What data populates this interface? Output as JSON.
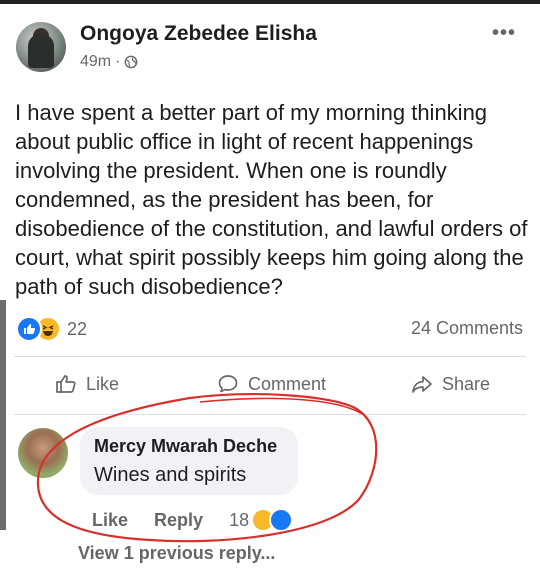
{
  "post": {
    "author": "Ongoya Zebedee Elisha",
    "time": "49m",
    "separator": "·",
    "more": "•••",
    "text": "I have spent a better part of my morning thinking about public office in light of recent happenings involving the president. When one is roundly condemned, as the president has been, for disobedience of the constitution, and lawful orders of court, what spirit possibly keeps him going along the path of such disobedience?",
    "reaction_count": "22",
    "comments_label": "24 Comments"
  },
  "actions": {
    "like": "Like",
    "comment": "Comment",
    "share": "Share"
  },
  "comment": {
    "author": "Mercy Mwarah Deche",
    "text": "Wines and spirits",
    "like": "Like",
    "reply": "Reply",
    "reaction_count": "18"
  },
  "view_previous": "View 1 previous reply...",
  "colors": {
    "accent": "#1877f2",
    "annotation": "#d9302c",
    "muted": "#65676b",
    "bubble": "#f0f2f5"
  }
}
